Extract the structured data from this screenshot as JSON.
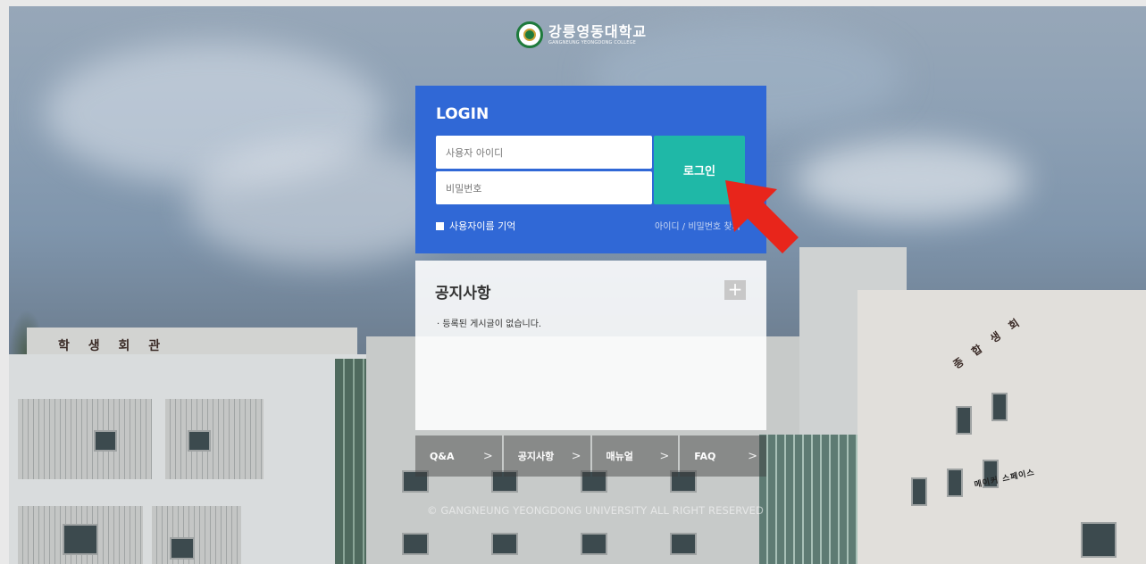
{
  "header": {
    "logo_korean": "강릉영동대학교",
    "logo_english": "GANGNEUNG YEONGDONG COLLEGE"
  },
  "login": {
    "title": "LOGIN",
    "id_placeholder": "사용자 아이디",
    "pw_placeholder": "비밀번호",
    "submit_label": "로그인",
    "remember_label": "사용자이름 기억",
    "find_label": "아이디 / 비밀번호 찾기"
  },
  "notice": {
    "title": "공지사항",
    "more_label": "+",
    "empty_message": "· 등록된 게시글이 없습니다."
  },
  "nav": {
    "items": [
      {
        "label": "Q&A",
        "arrow": ">"
      },
      {
        "label": "공지사항",
        "arrow": ">"
      },
      {
        "label": "매뉴얼",
        "arrow": ">"
      },
      {
        "label": "FAQ",
        "arrow": ">"
      }
    ]
  },
  "footer": {
    "copyright": "© GANGNEUNG YEONGDONG UNIVERSITY ALL RIGHT RESERVED"
  },
  "background": {
    "sign_left": "학 생 회 관",
    "sign_right": "종 합 생 회",
    "sign_small": "메이커 스페이스"
  },
  "colors": {
    "login_panel": "#3068d6",
    "login_button": "#1fb8a7",
    "annotation_arrow": "#e8251b"
  }
}
